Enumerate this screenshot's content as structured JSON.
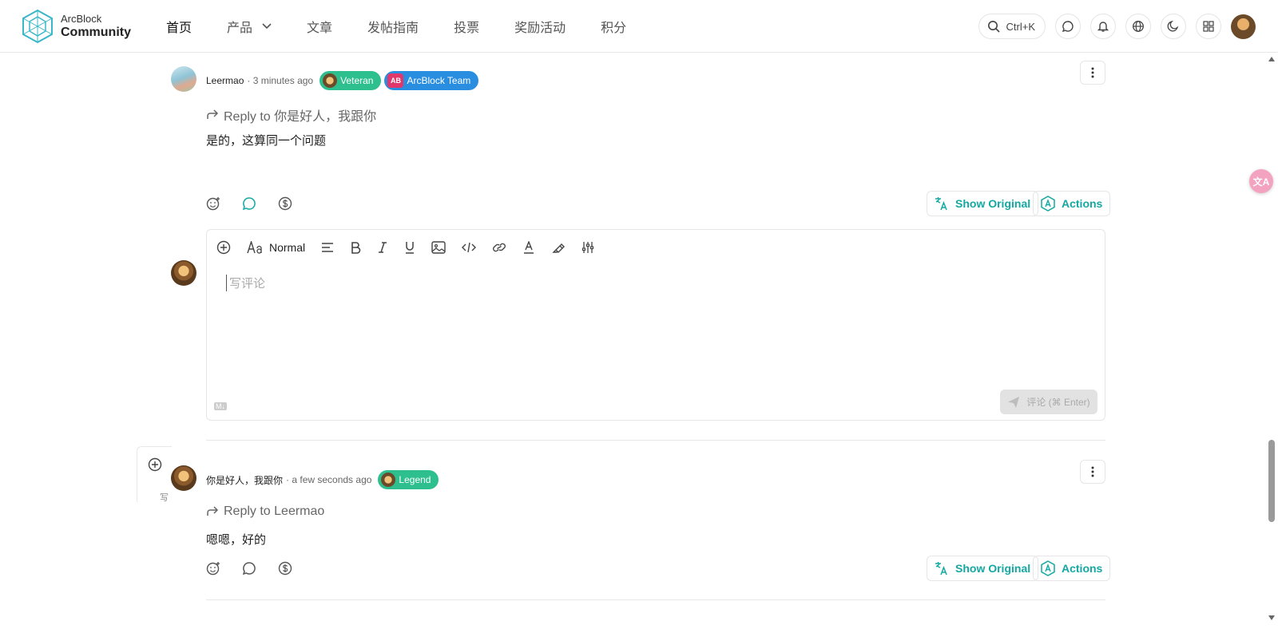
{
  "header": {
    "logo_top": "ArcBlock",
    "logo_bottom": "Community",
    "nav": [
      {
        "label": "首页"
      },
      {
        "label": "产品"
      },
      {
        "label": "文章"
      },
      {
        "label": "发帖指南"
      },
      {
        "label": "投票"
      },
      {
        "label": "奖励活动"
      },
      {
        "label": "积分"
      }
    ],
    "search_shortcut": "Ctrl+K"
  },
  "comments": [
    {
      "author": "Leermao",
      "time": "· 3 minutes ago",
      "badges": [
        "Veteran",
        "ArcBlock Team"
      ],
      "team_badge_initials": "AB",
      "reply_to": "Reply to 你是好人，我跟你",
      "body": "是的，这算同一个问题",
      "show_original": "Show Original",
      "actions": "Actions"
    },
    {
      "author": "你是好人，我跟你",
      "time": "· a few seconds ago",
      "badges": [
        "Legend"
      ],
      "reply_to": "Reply to Leermao",
      "body": "嗯嗯，好的",
      "show_original": "Show Original",
      "actions": "Actions"
    }
  ],
  "editor": {
    "format": "Normal",
    "placeholder": "写评论",
    "submit_label": "评论 (⌘ Enter)",
    "md_label": "M↓"
  },
  "side_panel": {
    "hint": "写"
  },
  "translate_fab": "文A",
  "colors": {
    "accent": "#14a8a2",
    "badge_green": "#2ebf8f",
    "badge_blue": "#2a8ee0"
  }
}
